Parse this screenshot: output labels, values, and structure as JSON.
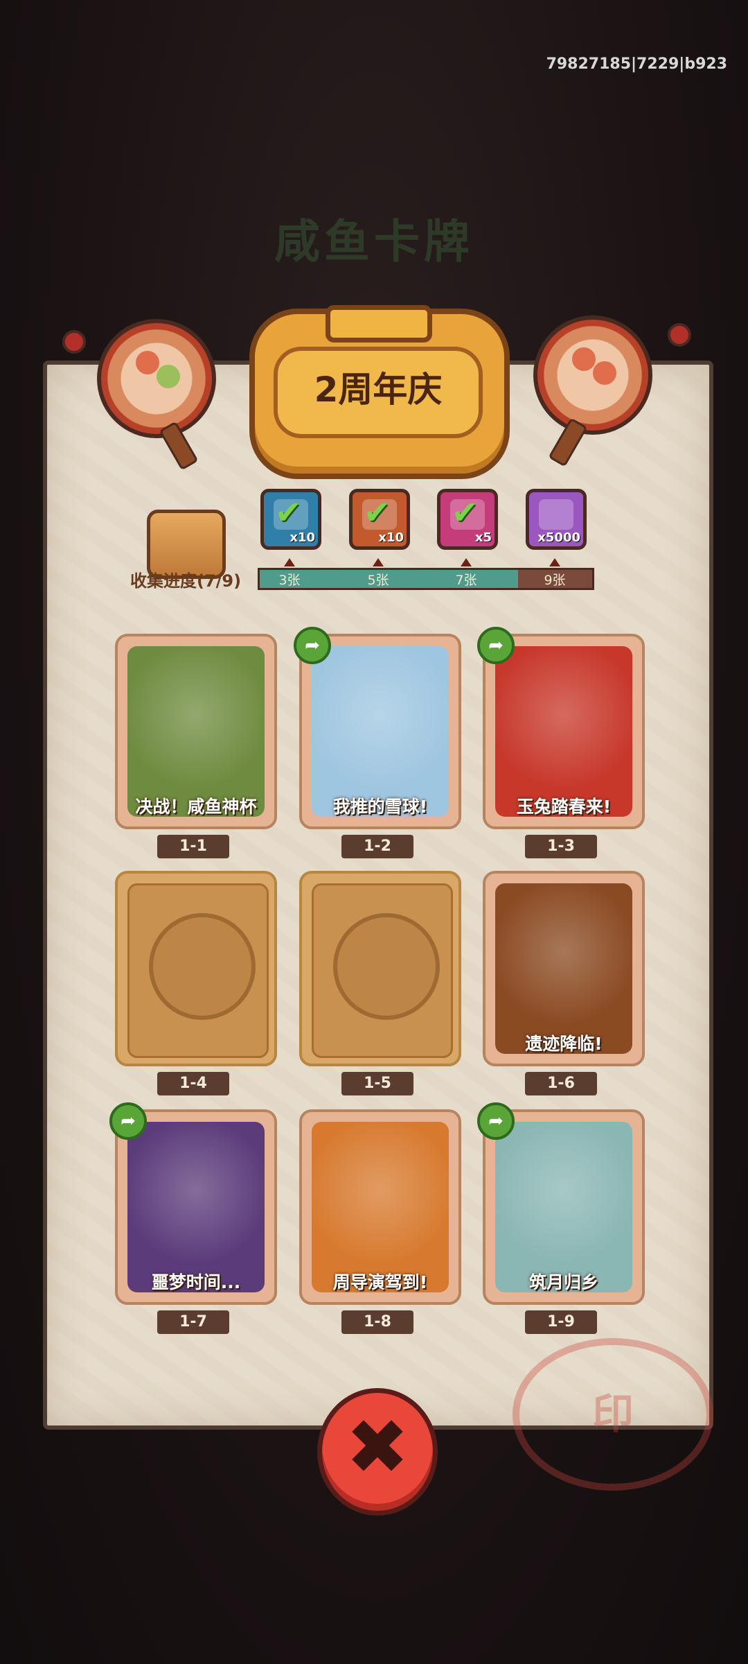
{
  "uid": "79827185|7229|b923",
  "background": {
    "title": "咸鱼卡牌"
  },
  "event": {
    "title": "2周年庆"
  },
  "collection": {
    "label": "收集进度(7/9)",
    "collected": 7,
    "total": 9,
    "milestones": [
      {
        "threshold_label": "3张",
        "reward_icon": "chest-icon",
        "qty": "x10",
        "claimed": true,
        "color": "#2f7fa8"
      },
      {
        "threshold_label": "5张",
        "reward_icon": "key-icon",
        "qty": "x10",
        "claimed": true,
        "color": "#c25a2e"
      },
      {
        "threshold_label": "7张",
        "reward_icon": "orb-icon",
        "qty": "x5",
        "claimed": true,
        "color": "#c43c7a"
      },
      {
        "threshold_label": "9张",
        "reward_icon": "crystal-icon",
        "qty": "x5000",
        "claimed": false,
        "color": "#9a57c0"
      }
    ]
  },
  "cards": [
    {
      "id": "1-1",
      "title": "决战！咸鱼神杯",
      "unlocked": true,
      "shareable": false,
      "bg": "#6f8b3f"
    },
    {
      "id": "1-2",
      "title": "我推的雪球!",
      "unlocked": true,
      "shareable": true,
      "bg": "#9fc6e0"
    },
    {
      "id": "1-3",
      "title": "玉兔踏春来!",
      "unlocked": true,
      "shareable": true,
      "bg": "#c7382b"
    },
    {
      "id": "1-4",
      "title": "",
      "unlocked": false,
      "shareable": false,
      "bg": "#c9914f"
    },
    {
      "id": "1-5",
      "title": "",
      "unlocked": false,
      "shareable": false,
      "bg": "#c9914f"
    },
    {
      "id": "1-6",
      "title": "遗迹降临!",
      "unlocked": true,
      "shareable": false,
      "bg": "#8a4a22"
    },
    {
      "id": "1-7",
      "title": "噩梦时间...",
      "unlocked": true,
      "shareable": true,
      "bg": "#5b3b7a"
    },
    {
      "id": "1-8",
      "title": "周导演驾到!",
      "unlocked": true,
      "shareable": false,
      "bg": "#d77a2f"
    },
    {
      "id": "1-9",
      "title": "筑月归乡",
      "unlocked": true,
      "shareable": true,
      "bg": "#8ab6b4"
    }
  ],
  "icons": {
    "share": "➦",
    "close": "✖",
    "check": "✔"
  }
}
